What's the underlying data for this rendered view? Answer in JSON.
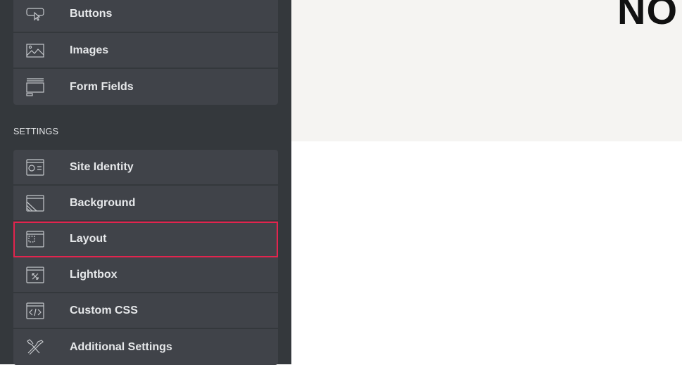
{
  "sidebar": {
    "group1": [
      {
        "label": "Buttons",
        "icon": "button-cursor-icon"
      },
      {
        "label": "Images",
        "icon": "image-icon"
      },
      {
        "label": "Form Fields",
        "icon": "form-fields-icon"
      }
    ],
    "section_label": "SETTINGS",
    "group2": [
      {
        "label": "Site Identity",
        "icon": "site-identity-icon"
      },
      {
        "label": "Background",
        "icon": "background-icon"
      },
      {
        "label": "Layout",
        "icon": "layout-icon",
        "active": true
      },
      {
        "label": "Lightbox",
        "icon": "lightbox-icon"
      },
      {
        "label": "Custom CSS",
        "icon": "custom-css-icon"
      },
      {
        "label": "Additional Settings",
        "icon": "tools-icon"
      }
    ]
  },
  "toggle": {
    "icon": "chevron-left-icon",
    "glyph": "‹"
  },
  "preview": {
    "heading": "NO"
  },
  "colors": {
    "panel": "#34383c",
    "item": "#404349",
    "highlight": "#e2244e",
    "preview_bg": "#f5f4f2"
  }
}
